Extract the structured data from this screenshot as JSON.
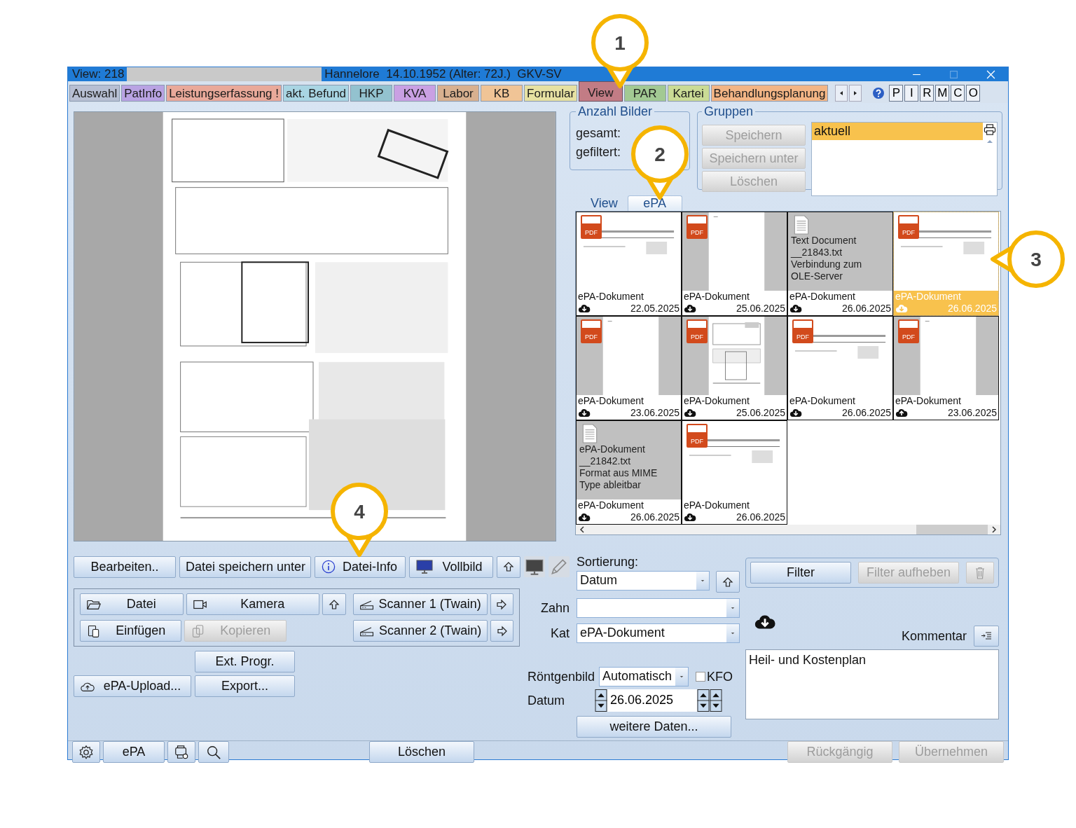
{
  "window": {
    "title": "View: 218",
    "patient": "Hannelore  14.10.1952 (Alter: 72J.)  GKV-SV"
  },
  "tabs": [
    {
      "label": "Auswahl",
      "color": "#b7bfd3",
      "selected": false
    },
    {
      "label": "PatInfo",
      "color": "#b9a3e3",
      "selected": false
    },
    {
      "label": "Leistungserfassung !",
      "color": "#e9a99a",
      "selected": false
    },
    {
      "label": "akt. Befund",
      "color": "#a9d5e3",
      "selected": false
    },
    {
      "label": "HKP",
      "color": "#93c2cf",
      "selected": false
    },
    {
      "label": "KVA",
      "color": "#c9a0e3",
      "selected": false
    },
    {
      "label": "Labor",
      "color": "#d8b08f",
      "selected": false
    },
    {
      "label": "KB",
      "color": "#f0c496",
      "selected": false
    },
    {
      "label": "Formular",
      "color": "#e6e1a2",
      "selected": false
    },
    {
      "label": "View",
      "color": "#c27c85",
      "selected": true
    },
    {
      "label": "PAR",
      "color": "#a2c993",
      "selected": false
    },
    {
      "label": "Kartei",
      "color": "#cadb95",
      "selected": false
    },
    {
      "label": "Behandlungsplanung",
      "color": "#f3b585",
      "selected": false
    }
  ],
  "quick_buttons": [
    "P",
    "I",
    "R",
    "M",
    "C",
    "O"
  ],
  "anzahl_bilder": {
    "title": "Anzahl Bilder",
    "rows": [
      "gesamt:",
      "gefiltert:"
    ]
  },
  "gruppen": {
    "title": "Gruppen",
    "buttons": [
      {
        "label": "Speichern",
        "disabled": true
      },
      {
        "label": "Speichern unter",
        "disabled": true
      },
      {
        "label": "Löschen",
        "disabled": true
      }
    ],
    "items": [
      {
        "label": "aktuell",
        "selected": true
      }
    ]
  },
  "view_tabs": [
    {
      "label": "View",
      "selected": false
    },
    {
      "label": "ePA",
      "selected": true
    }
  ],
  "thumbnails": [
    {
      "kind": "pdf",
      "file_label": "PDF",
      "category": "ePA-Dokument",
      "date": "22.05.2025",
      "uploaded": false,
      "selected": false
    },
    {
      "kind": "pdf",
      "file_label": "PDF",
      "category": "ePA-Dokument",
      "date": "25.06.2025",
      "uploaded": false,
      "selected": false
    },
    {
      "kind": "text",
      "lines": [
        "Text Document",
        "__21843.txt",
        "Verbindung zum",
        "OLE-Server"
      ],
      "category": "ePA-Dokument",
      "date": "26.06.2025",
      "uploaded": false,
      "selected": false
    },
    {
      "kind": "pdf",
      "file_label": "PDF",
      "category": "ePA-Dokument",
      "date": "26.06.2025",
      "uploaded": false,
      "selected": true
    },
    {
      "kind": "pdf",
      "file_label": "PDF",
      "category": "ePA-Dokument",
      "date": "23.06.2025",
      "uploaded": false,
      "selected": false
    },
    {
      "kind": "pdf",
      "file_label": "PDF",
      "category": "ePA-Dokument",
      "date": "25.06.2025",
      "uploaded": false,
      "selected": false
    },
    {
      "kind": "pdf",
      "file_label": "PDF",
      "category": "ePA-Dokument",
      "date": "26.06.2025",
      "uploaded": false,
      "selected": false
    },
    {
      "kind": "pdf",
      "file_label": "PDF",
      "category": "ePA-Dokument",
      "date": "23.06.2025",
      "uploaded": true,
      "selected": false
    },
    {
      "kind": "text",
      "lines": [
        "ePA-Dokument",
        "__21842.txt",
        "Format aus MIME",
        "Type ableitbar"
      ],
      "category": "ePA-Dokument",
      "date": "26.06.2025",
      "uploaded": false,
      "selected": false
    },
    {
      "kind": "pdf",
      "file_label": "PDF",
      "category": "ePA-Dokument",
      "date": "26.06.2025",
      "uploaded": false,
      "selected": false
    }
  ],
  "preview_buttons": [
    "Bearbeiten..",
    "Datei speichern unter",
    "Datei-Info",
    "Vollbild"
  ],
  "capture_buttons": [
    {
      "label": "Datei",
      "disabled": false
    },
    {
      "label": "Kamera",
      "disabled": false
    },
    {
      "label": "Scanner 1 (Twain)",
      "disabled": false
    },
    {
      "label": "Einfügen",
      "disabled": false
    },
    {
      "label": "Kopieren",
      "disabled": true
    },
    {
      "label": "Scanner 2 (Twain)",
      "disabled": false
    }
  ],
  "extra_buttons": [
    "Ext. Progr.",
    "ePA-Upload...",
    "Export..."
  ],
  "sort": {
    "label": "Sortierung:",
    "value": "Datum"
  },
  "filter": {
    "buttons": [
      {
        "label": "Filter",
        "disabled": false
      },
      {
        "label": "Filter aufheben",
        "disabled": true
      }
    ],
    "clear_disabled": true
  },
  "fields": {
    "zahn": {
      "label": "Zahn"
    },
    "kat": {
      "label": "Kat",
      "value": "ePA-Dokument"
    },
    "roentgenbild": {
      "label": "Röntgenbild",
      "value": "Automatisch"
    },
    "kfo": {
      "label": "KFO",
      "checked": false
    },
    "datum": {
      "label": "Datum",
      "value": "26.06.2025"
    },
    "more": "weitere Daten..."
  },
  "kommentar": {
    "label": "Kommentar",
    "value": "Heil- und Kostenplan"
  },
  "bottom_bar": {
    "epa": "ePA",
    "delete": "Löschen",
    "buttons": [
      {
        "label": "Rückgängig",
        "disabled": true
      },
      {
        "label": "Übernehmen",
        "disabled": true
      }
    ]
  },
  "callouts": [
    {
      "label": "1",
      "pointer_left": false
    },
    {
      "label": "2",
      "pointer_left": false
    },
    {
      "label": "3",
      "pointer_left": true
    },
    {
      "label": "4",
      "pointer_left": false
    }
  ]
}
